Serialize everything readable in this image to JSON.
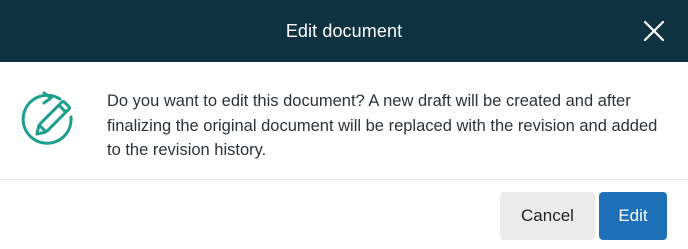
{
  "dialog": {
    "title": "Edit document",
    "close_icon": "close-icon",
    "message_icon": "edit-revision-icon",
    "message": "Do you want to edit this document? A new draft will be created and after finalizing the original document will be replaced with the revision and added to the revision history.",
    "buttons": {
      "cancel": "Cancel",
      "edit": "Edit"
    }
  },
  "colors": {
    "header_bg": "#0f3341",
    "icon_teal": "#1e9e8e",
    "primary": "#1d70b8",
    "secondary_bg": "#ebebeb"
  }
}
